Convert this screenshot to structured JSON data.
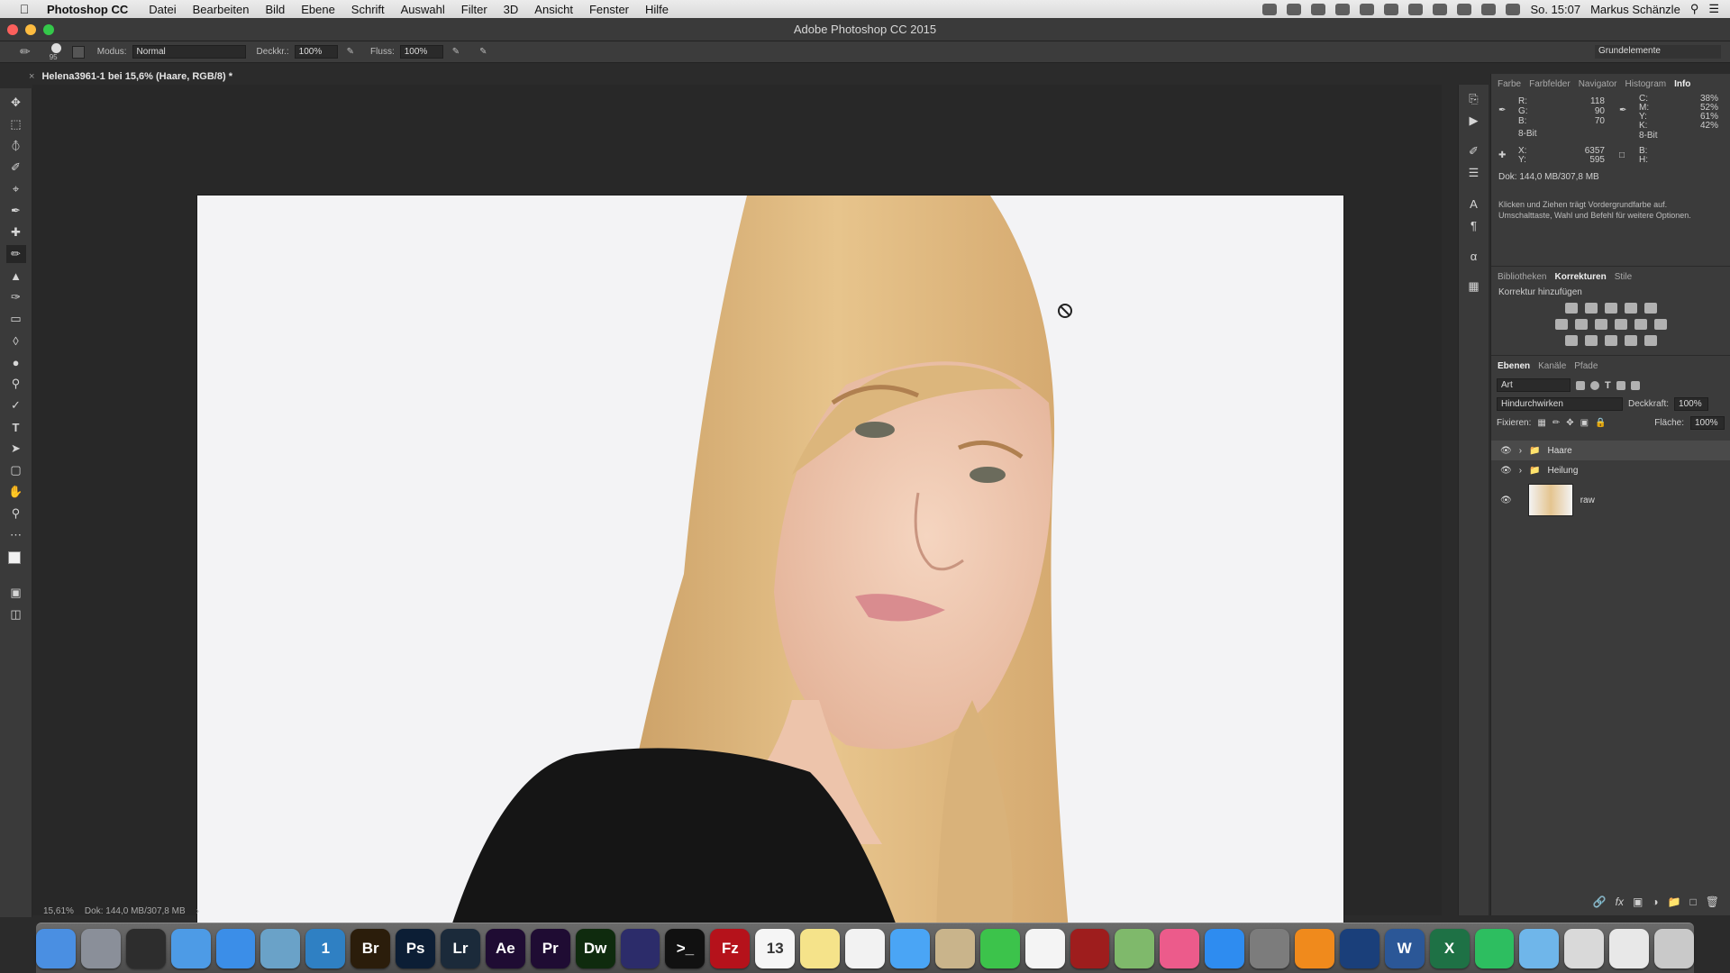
{
  "menubar": {
    "app_name": "Photoshop CC",
    "items": [
      "Datei",
      "Bearbeiten",
      "Bild",
      "Ebene",
      "Schrift",
      "Auswahl",
      "Filter",
      "3D",
      "Ansicht",
      "Fenster",
      "Hilfe"
    ],
    "clock": "So. 15:07",
    "user": "Markus Schänzle"
  },
  "window": {
    "title": "Adobe Photoshop CC 2015"
  },
  "options": {
    "brush_size": "95",
    "mode_label": "Modus:",
    "mode_value": "Normal",
    "opacity_label": "Deckkr.:",
    "opacity_value": "100%",
    "flow_label": "Fluss:",
    "flow_value": "100%",
    "workspace": "Grundelemente"
  },
  "document": {
    "tab_title": "Helena3961-1 bei 15,6% (Haare, RGB/8) *"
  },
  "info_panel": {
    "tabs": [
      "Farbe",
      "Farbfelder",
      "Navigator",
      "Histogram",
      "Info"
    ],
    "active_tab": "Info",
    "r_label": "R:",
    "r": "118",
    "g_label": "G:",
    "g": "90",
    "b_label": "B:",
    "b": "70",
    "bit_left": "8-Bit",
    "c_label": "C:",
    "c": "38%",
    "m_label": "M:",
    "m": "52%",
    "y_label": "Y:",
    "y": "61%",
    "k_label": "K:",
    "k": "42%",
    "bit_right": "8-Bit",
    "x_label": "X:",
    "x": "6357",
    "ypos_label": "Y:",
    "ypos": "595",
    "w_label": "B:",
    "h_label": "H:",
    "doc_size": "Dok: 144,0 MB/307,8 MB",
    "hint": "Klicken und Ziehen trägt Vordergrundfarbe auf. Umschalttaste, Wahl und Befehl für weitere Optionen."
  },
  "adjust_panel": {
    "tabs": [
      "Bibliotheken",
      "Korrekturen",
      "Stile"
    ],
    "active_tab": "Korrekturen",
    "add_label": "Korrektur hinzufügen"
  },
  "layers_panel": {
    "tabs": [
      "Ebenen",
      "Kanäle",
      "Pfade"
    ],
    "active_tab": "Ebenen",
    "filter_label": "Art",
    "blend_mode": "Hindurchwirken",
    "opacity_label": "Deckkraft:",
    "opacity_value": "100%",
    "lock_label": "Fixieren:",
    "fill_label": "Fläche:",
    "fill_value": "100%",
    "layers": [
      {
        "name": "Haare",
        "type": "group",
        "selected": true
      },
      {
        "name": "Heilung",
        "type": "group",
        "selected": false
      },
      {
        "name": "raw",
        "type": "image",
        "selected": false
      }
    ]
  },
  "statusbar": {
    "zoom": "15,61%",
    "doc": "Dok: 144,0 MB/307,8 MB"
  },
  "dock": {
    "apps": [
      {
        "icon": "finder-icon",
        "label": "",
        "color": "#4a8fe2"
      },
      {
        "icon": "launchpad-icon",
        "label": "",
        "color": "#8a8f99"
      },
      {
        "icon": "mission-control-icon",
        "label": "",
        "color": "#2d2d2d"
      },
      {
        "icon": "folder-icon",
        "label": "",
        "color": "#4d9be6"
      },
      {
        "icon": "safari-icon",
        "label": "",
        "color": "#3b8ee8"
      },
      {
        "icon": "preview-icon",
        "label": "",
        "color": "#6aa2c8"
      },
      {
        "icon": "1password-icon",
        "label": "1",
        "color": "#2f80c3"
      },
      {
        "icon": "bridge-icon",
        "label": "Br",
        "color": "#2b1d0b"
      },
      {
        "icon": "photoshop-icon",
        "label": "Ps",
        "color": "#0c1e35"
      },
      {
        "icon": "lightroom-icon",
        "label": "Lr",
        "color": "#1b2a3a"
      },
      {
        "icon": "after-effects-icon",
        "label": "Ae",
        "color": "#1f0c33"
      },
      {
        "icon": "premiere-icon",
        "label": "Pr",
        "color": "#1f0c33"
      },
      {
        "icon": "dreamweaver-icon",
        "label": "Dw",
        "color": "#0f2b0e"
      },
      {
        "icon": "imovie-icon",
        "label": "",
        "color": "#2c2c6a"
      },
      {
        "icon": "terminal-icon",
        "label": ">_",
        "color": "#111111"
      },
      {
        "icon": "filezilla-icon",
        "label": "Fz",
        "color": "#b5121b"
      },
      {
        "icon": "calendar-icon",
        "label": "13",
        "color": "#f5f5f5"
      },
      {
        "icon": "notes-icon",
        "label": "",
        "color": "#f5e38a"
      },
      {
        "icon": "reminders-icon",
        "label": "",
        "color": "#f2f2f2"
      },
      {
        "icon": "messages-icon",
        "label": "",
        "color": "#4aa5f5"
      },
      {
        "icon": "contacts-icon",
        "label": "",
        "color": "#c9b48b"
      },
      {
        "icon": "facetime-icon",
        "label": "",
        "color": "#3cc34b"
      },
      {
        "icon": "photos-icon",
        "label": "",
        "color": "#f4f4f4"
      },
      {
        "icon": "photo-booth-icon",
        "label": "",
        "color": "#9e1d1d"
      },
      {
        "icon": "maps-icon",
        "label": "",
        "color": "#7fb96b"
      },
      {
        "icon": "itunes-icon",
        "label": "",
        "color": "#ec5b8b"
      },
      {
        "icon": "app-store-icon",
        "label": "",
        "color": "#2e8cf0"
      },
      {
        "icon": "system-preferences-icon",
        "label": "",
        "color": "#7c7c7c"
      },
      {
        "icon": "vlc-icon",
        "label": "",
        "color": "#f08a1c"
      },
      {
        "icon": "quicktime-icon",
        "label": "",
        "color": "#1a3f7a"
      },
      {
        "icon": "word-icon",
        "label": "W",
        "color": "#2b5797"
      },
      {
        "icon": "excel-icon",
        "label": "X",
        "color": "#1e7145"
      },
      {
        "icon": "evernote-icon",
        "label": "",
        "color": "#2dbe60"
      },
      {
        "icon": "downloads-folder-icon",
        "label": "",
        "color": "#6fb6ea"
      },
      {
        "icon": "brushes-icon",
        "label": "",
        "color": "#d9d9d9"
      },
      {
        "icon": "documents-icon",
        "label": "",
        "color": "#e8e8e8"
      },
      {
        "icon": "trash-icon",
        "label": "",
        "color": "#c9c9c9"
      }
    ]
  }
}
